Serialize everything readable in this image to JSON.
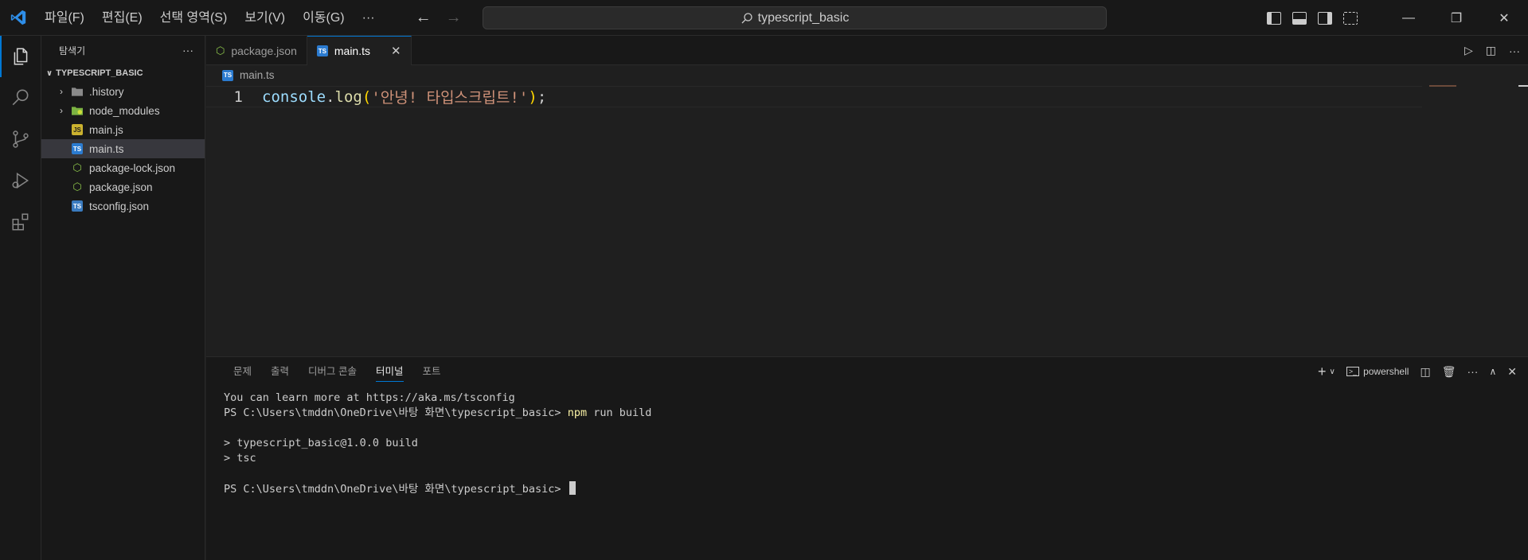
{
  "menu": [
    "파일(F)",
    "편집(E)",
    "선택 영역(S)",
    "보기(V)",
    "이동(G)",
    "···"
  ],
  "search": {
    "text": "typescript_basic"
  },
  "sidebar": {
    "title": "탐색기",
    "root": "TYPESCRIPT_BASIC",
    "items": [
      {
        "label": ".history",
        "type": "folder",
        "icon": "folder-icon"
      },
      {
        "label": "node_modules",
        "type": "folder",
        "icon": "node-folder-icon"
      },
      {
        "label": "main.js",
        "type": "file",
        "icon": "js-file-icon",
        "badge": "JS"
      },
      {
        "label": "main.ts",
        "type": "file",
        "icon": "ts-file-icon",
        "badge": "TS"
      },
      {
        "label": "package-lock.json",
        "type": "file",
        "icon": "node-json-icon",
        "badge": "⬡"
      },
      {
        "label": "package.json",
        "type": "file",
        "icon": "node-json-icon",
        "badge": "⬡"
      },
      {
        "label": "tsconfig.json",
        "type": "file",
        "icon": "tsconfig-icon",
        "badge": "TS"
      }
    ]
  },
  "tabs": [
    {
      "label": "package.json",
      "active": false
    },
    {
      "label": "main.ts",
      "active": true
    }
  ],
  "breadcrumb": "main.ts",
  "code": {
    "line_number": "1",
    "obj": "console",
    "dot": ".",
    "fn": "log",
    "open": "(",
    "str": "'안녕! 타입스크립트!'",
    "close": ")",
    "semi": ";"
  },
  "panel": {
    "tabs": [
      "문제",
      "출력",
      "디버그 콘솔",
      "터미널",
      "포트"
    ],
    "active_tab": "터미널",
    "shell": "powershell",
    "terminal": {
      "line1": "You can learn more at https://aka.ms/tsconfig",
      "prompt1": "PS C:\\Users\\tmddn\\OneDrive\\바탕 화면\\typescript_basic> ",
      "cmd1": "npm",
      "cmd1_rest": " run build",
      "out1": "> typescript_basic@1.0.0 build",
      "out2": "> tsc",
      "prompt2": "PS C:\\Users\\tmddn\\OneDrive\\바탕 화면\\typescript_basic> "
    }
  },
  "colors": {
    "accent": "#0078d4",
    "background": "#1f1f1f",
    "sidebar": "#181818",
    "string": "#ce9178",
    "function": "#dcdcaa",
    "variable": "#9cdcfe",
    "bracket": "#ffd700"
  }
}
